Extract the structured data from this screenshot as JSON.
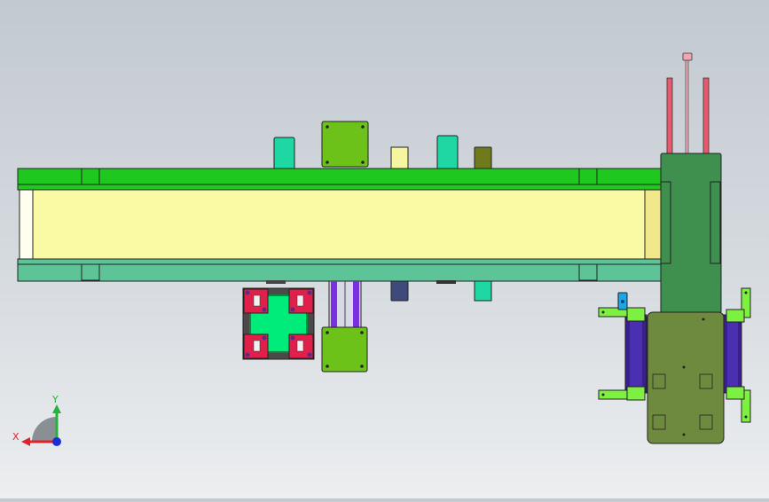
{
  "viewport": {
    "background_top": "#c2c9d0",
    "background_bottom": "#eceef0"
  },
  "triad": {
    "x_label": "X",
    "y_label": "Y",
    "x_color": "#e0222a",
    "y_color": "#23b23a",
    "z_color": "#1b2fd6"
  },
  "colors": {
    "rail_green": "#1fc81f",
    "rail_teal": "#5cc496",
    "belt_yellow": "#fbfaa4",
    "motor_green": "#6dc21a",
    "gripper_green": "#00ec7a",
    "gripper_red": "#e0204a",
    "carriage_olive": "#6e8a3f",
    "column_green": "#3f8f4f",
    "guide_pink": "#e8596e",
    "rail_purple": "#3a1f8f",
    "bracket_green": "#7ef042",
    "sensor_blue": "#1aa6e8"
  }
}
